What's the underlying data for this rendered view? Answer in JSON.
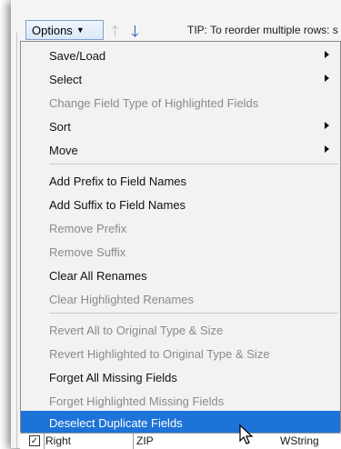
{
  "toolbar": {
    "options_label": "Options",
    "tip_text": "TIP: To reorder multiple rows: s"
  },
  "menu": {
    "items": [
      {
        "label": "Save/Load",
        "enabled": true,
        "submenu": true
      },
      {
        "label": "Select",
        "enabled": true,
        "submenu": true
      },
      {
        "label": "Change Field Type of Highlighted Fields",
        "enabled": false,
        "submenu": false
      },
      {
        "label": "Sort",
        "enabled": true,
        "submenu": true
      },
      {
        "label": "Move",
        "enabled": true,
        "submenu": true
      },
      {
        "label": "Add Prefix to Field Names",
        "enabled": true,
        "submenu": false
      },
      {
        "label": "Add Suffix to Field Names",
        "enabled": true,
        "submenu": false
      },
      {
        "label": "Remove Prefix",
        "enabled": false,
        "submenu": false
      },
      {
        "label": "Remove Suffix",
        "enabled": false,
        "submenu": false
      },
      {
        "label": "Clear All Renames",
        "enabled": true,
        "submenu": false
      },
      {
        "label": "Clear Highlighted Renames",
        "enabled": false,
        "submenu": false
      },
      {
        "label": "Revert All to Original Type & Size",
        "enabled": false,
        "submenu": false
      },
      {
        "label": "Revert Highlighted to Original Type & Size",
        "enabled": false,
        "submenu": false
      },
      {
        "label": "Forget All Missing Fields",
        "enabled": true,
        "submenu": false
      },
      {
        "label": "Forget Highlighted Missing Fields",
        "enabled": false,
        "submenu": false
      },
      {
        "label": "Deselect Duplicate Fields",
        "enabled": true,
        "submenu": false,
        "highlighted": true
      }
    ]
  },
  "grid_row": {
    "checked": true,
    "col1": "Right",
    "col2": "ZIP",
    "col3": "WString"
  },
  "colors": {
    "highlight": "#1e73d8",
    "disabled_text": "#8a8a8a",
    "arrow_down": "#1f5fbf"
  }
}
